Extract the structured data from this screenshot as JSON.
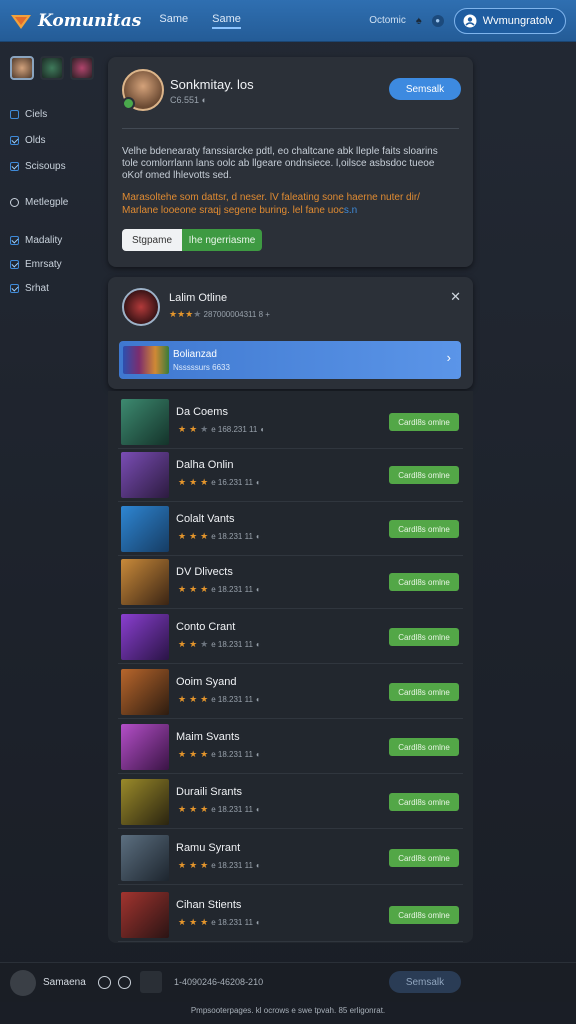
{
  "header": {
    "brand": "Komunitas",
    "nav": [
      "Same",
      "Same"
    ],
    "right_text": "Octomic",
    "signin_label": "Wvmungratolv"
  },
  "sidebar": {
    "items": [
      {
        "label": "Ciels",
        "icon": "doc-icon"
      },
      {
        "label": "Olds",
        "icon": "check-icon"
      },
      {
        "label": "Scisoups",
        "icon": "check-icon"
      },
      {
        "label": "Metlegple",
        "icon": "pin-icon"
      },
      {
        "label": "Madality",
        "icon": "check-icon"
      },
      {
        "label": "Emrsaty",
        "icon": "check-icon"
      },
      {
        "label": "Srhat",
        "icon": "check-icon"
      }
    ]
  },
  "profile": {
    "name": "Sonkmitay. los",
    "sub": "C6.551",
    "button": "Semsalk",
    "description": "Velhe bdenearaty fanssiarcke pdtl, eo chaltcane abk lleple faits sloarins tole comlorrlann lans oolc ab llgeare ondnsiece. l,oilsce asbsdoc tueoe oKof omed lhlevotts sed.",
    "note_orange": "Marasoltehe som dattsr, d neser. lV faleating sone haerne nuter dir/ Marlane looeone sraqj segene buring. lel fane uoc",
    "note_blue": "s.n",
    "seg_left": "Stgpame",
    "seg_right": "Ihe ngerriasme"
  },
  "notification": {
    "name": "Lalim Otline",
    "meta": "287000004311 8 + ",
    "banner_title": "Bolianzad",
    "banner_sub": "Nsssssurs 6633"
  },
  "games": [
    {
      "name": "Da Coems",
      "meta": "e 168.231 11",
      "button": "Cardl8s omlne",
      "rating": 2
    },
    {
      "name": "Dalha Onlin",
      "meta": "e 16.231 11",
      "button": "Cardl8s omlne",
      "rating": 3
    },
    {
      "name": "Colalt Vants",
      "meta": "e 18.231 11",
      "button": "Cardl8s omlne",
      "rating": 3
    },
    {
      "name": "DV Dlivects",
      "meta": "e 18.231 11",
      "button": "Cardl8s omlne",
      "rating": 3
    },
    {
      "name": "Conto Crant",
      "meta": "e 18.231 11",
      "button": "Cardl8s omlne",
      "rating": 2
    },
    {
      "name": "Ooim Syand",
      "meta": "e 18.231 11",
      "button": "Cardl8s omlne",
      "rating": 3
    },
    {
      "name": "Maim Svants",
      "meta": "e 18.231 11",
      "button": "Cardl8s omlne",
      "rating": 3
    },
    {
      "name": "Duraili Srants",
      "meta": "e 18.231 11",
      "button": "Cardl8s omlne",
      "rating": 3
    },
    {
      "name": "Ramu Syrant",
      "meta": "e 18.231 11",
      "button": "Cardl8s omlne",
      "rating": 3
    },
    {
      "name": "Cihan Stients",
      "meta": "e 18.231 11",
      "button": "Cardl8s omlne",
      "rating": 3
    }
  ],
  "bottom": {
    "name": "Samaena",
    "code": "1-4090246-46208-210",
    "button": "Semsalk"
  },
  "footer": "Pmpsooterpages. kl ocrows e swe tpvah. 85 erligonrat."
}
